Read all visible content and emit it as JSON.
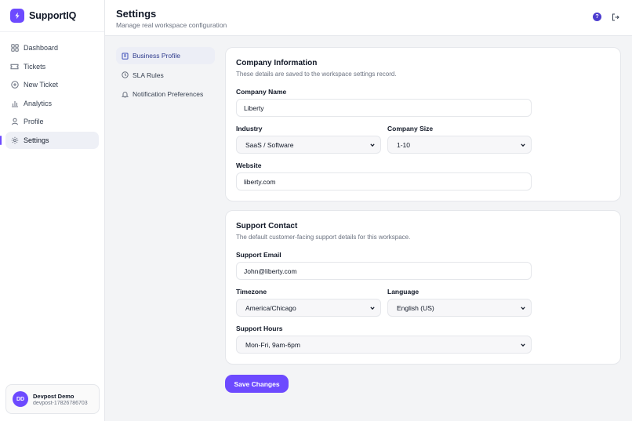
{
  "app": {
    "name": "SupportIQ"
  },
  "sidebar": {
    "items": [
      {
        "label": "Dashboard",
        "icon": "dashboard-icon"
      },
      {
        "label": "Tickets",
        "icon": "ticket-icon"
      },
      {
        "label": "New Ticket",
        "icon": "plus-circle-icon"
      },
      {
        "label": "Analytics",
        "icon": "bar-chart-icon"
      },
      {
        "label": "Profile",
        "icon": "user-icon"
      },
      {
        "label": "Settings",
        "icon": "gear-icon",
        "active": true
      }
    ],
    "user": {
      "initials": "DD",
      "name": "Devpost Demo",
      "id": "devpost-17826786703"
    }
  },
  "header": {
    "title": "Settings",
    "subtitle": "Manage real workspace configuration",
    "help_label": "?"
  },
  "subnav": {
    "items": [
      {
        "label": "Business Profile",
        "icon": "building-icon",
        "active": true
      },
      {
        "label": "SLA Rules",
        "icon": "clock-icon"
      },
      {
        "label": "Notification Preferences",
        "icon": "bell-icon"
      }
    ]
  },
  "company": {
    "title": "Company Information",
    "description": "These details are saved to the workspace settings record.",
    "name_label": "Company Name",
    "name_value": "Liberty",
    "industry_label": "Industry",
    "industry_value": "SaaS / Software",
    "size_label": "Company Size",
    "size_value": "1-10",
    "website_label": "Website",
    "website_value": "liberty.com"
  },
  "support": {
    "title": "Support Contact",
    "description": "The default customer-facing support details for this workspace.",
    "email_label": "Support Email",
    "email_value": "John@liberty.com",
    "timezone_label": "Timezone",
    "timezone_value": "America/Chicago",
    "language_label": "Language",
    "language_value": "English (US)",
    "hours_label": "Support Hours",
    "hours_value": "Mon-Fri, 9am-6pm"
  },
  "actions": {
    "save_label": "Save Changes"
  },
  "colors": {
    "accent": "#6d4aff",
    "help": "#4c3ccf"
  }
}
